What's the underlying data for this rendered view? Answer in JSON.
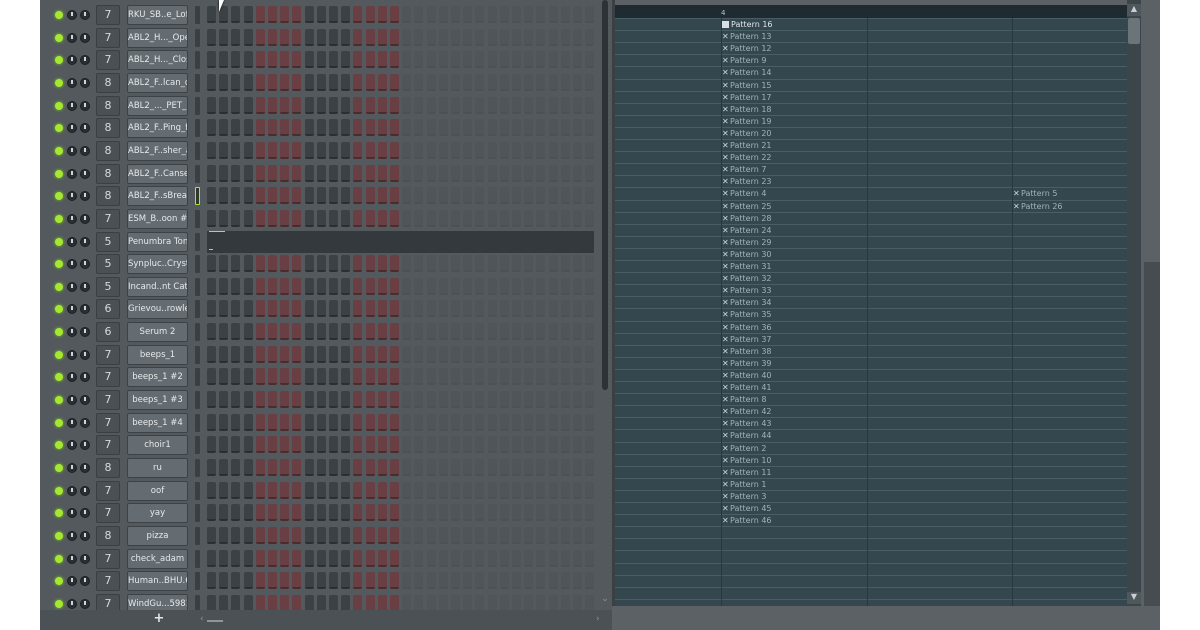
{
  "rack": {
    "add_label": "+",
    "channels": [
      {
        "num": "7",
        "name": "RKU_SB..e_Lofi"
      },
      {
        "num": "7",
        "name": "ABL2_H..._Open"
      },
      {
        "num": "7",
        "name": "ABL2_H..._Close"
      },
      {
        "num": "8",
        "name": "ABL2_F..lcan_d"
      },
      {
        "num": "8",
        "name": "ABL2_..._PET_b"
      },
      {
        "num": "8",
        "name": "ABL2_F..Ping_f"
      },
      {
        "num": "8",
        "name": "ABL2_F..sher_a"
      },
      {
        "num": "8",
        "name": "ABL2_F..Canset"
      },
      {
        "num": "8",
        "name": "ABL2_F..sBreak",
        "selected": true
      },
      {
        "num": "7",
        "name": "ESM_B..oon #2"
      },
      {
        "num": "5",
        "name": "Penumbra Tone",
        "pianoroll": true
      },
      {
        "num": "5",
        "name": "Synpluc..Crystal"
      },
      {
        "num": "5",
        "name": "Incand..nt Cats"
      },
      {
        "num": "6",
        "name": "Grievou..rowler"
      },
      {
        "num": "6",
        "name": "Serum 2"
      },
      {
        "num": "7",
        "name": "beeps_1"
      },
      {
        "num": "7",
        "name": "beeps_1 #2"
      },
      {
        "num": "7",
        "name": "beeps_1 #3"
      },
      {
        "num": "7",
        "name": "beeps_1 #4"
      },
      {
        "num": "7",
        "name": "choir1"
      },
      {
        "num": "8",
        "name": "ru"
      },
      {
        "num": "7",
        "name": "oof"
      },
      {
        "num": "7",
        "name": "yay"
      },
      {
        "num": "8",
        "name": "pizza"
      },
      {
        "num": "7",
        "name": "check_adam"
      },
      {
        "num": "7",
        "name": "Human..BHU.63"
      },
      {
        "num": "7",
        "name": "WindGu...59814"
      }
    ]
  },
  "playlist": {
    "ruler_bar": "4",
    "clips_col1": [
      "Pattern 16",
      "Pattern 13",
      "Pattern 12",
      "Pattern 9",
      "Pattern 14",
      "Pattern 15",
      "Pattern 17",
      "Pattern 18",
      "Pattern 19",
      "Pattern 20",
      "Pattern 21",
      "Pattern 22",
      "Pattern 7",
      "Pattern 23",
      "Pattern 4",
      "Pattern 25",
      "Pattern 28",
      "Pattern 24",
      "Pattern 29",
      "Pattern 30",
      "Pattern 31",
      "Pattern 32",
      "Pattern 33",
      "Pattern 34",
      "Pattern 35",
      "Pattern 36",
      "Pattern 37",
      "Pattern 38",
      "Pattern 39",
      "Pattern 40",
      "Pattern 41",
      "Pattern 8",
      "Pattern 42",
      "Pattern 43",
      "Pattern 44",
      "Pattern 2",
      "Pattern 10",
      "Pattern 11",
      "Pattern 1",
      "Pattern 3",
      "Pattern 45",
      "Pattern 46"
    ],
    "clips_col2": [
      {
        "row": 14,
        "name": "Pattern 5"
      },
      {
        "row": 15,
        "name": "Pattern 26"
      }
    ]
  }
}
